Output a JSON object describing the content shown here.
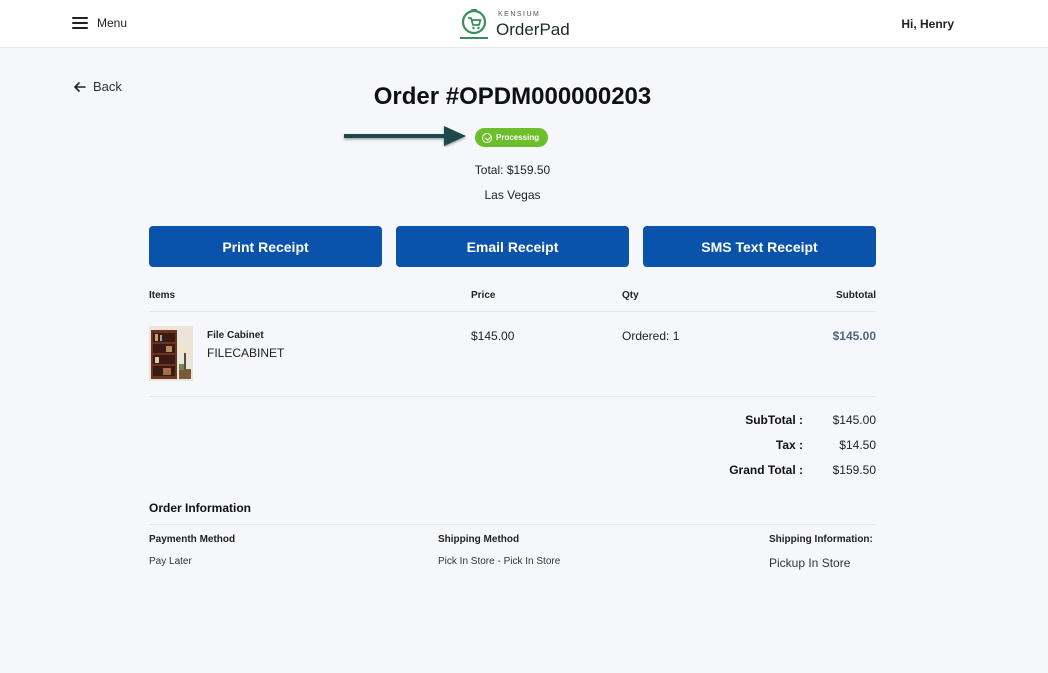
{
  "header": {
    "menu_label": "Menu",
    "logo_small": "KENSIUM",
    "logo_big": "OrderPad",
    "greeting": "Hi, Henry"
  },
  "nav": {
    "back_label": "Back"
  },
  "order": {
    "title": "Order #OPDM000000203",
    "status": "Processing",
    "total": "Total: $159.50",
    "location": "Las Vegas"
  },
  "actions": {
    "print": "Print Receipt",
    "email": "Email Receipt",
    "sms": "SMS Text Receipt"
  },
  "table": {
    "headers": {
      "items": "Items",
      "price": "Price",
      "qty": "Qty",
      "subtotal": "Subtotal"
    },
    "rows": [
      {
        "name": "File Cabinet",
        "sku": "FILECABINET",
        "price": "$145.00",
        "qty": "Ordered: 1",
        "subtotal": "$145.00"
      }
    ]
  },
  "totals": {
    "subtotal_label": "SubTotal :",
    "subtotal_value": "$145.00",
    "tax_label": "Tax :",
    "tax_value": "$14.50",
    "grand_label": "Grand Total :",
    "grand_value": "$159.50"
  },
  "info": {
    "title": "Order Information",
    "payment_label": "Paymenth Method",
    "payment_value": "Pay Later",
    "shipping_label": "Shipping Method",
    "shipping_value": "Pick In Store - Pick In Store",
    "shipinfo_label": "Shipping Information:",
    "shipinfo_value": "Pickup In Store"
  },
  "colors": {
    "primary": "#0a53ad",
    "status": "#6cbf2a",
    "logo": "#3a8f5c",
    "arrow": "#1e4a4a"
  },
  "icons": [
    "hamburger-icon",
    "orderpad-logo-icon",
    "back-arrow-icon",
    "check-circle-icon",
    "pointer-arrow-icon"
  ]
}
